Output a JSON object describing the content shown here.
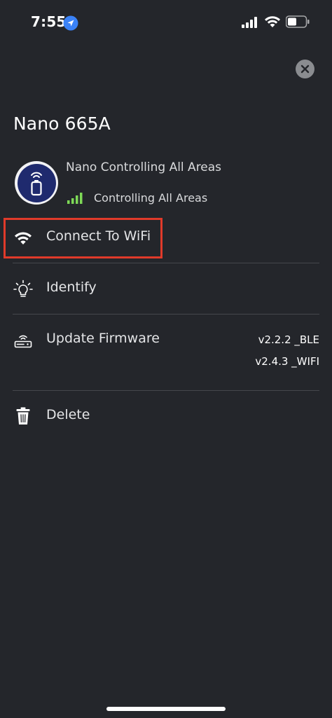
{
  "status_bar": {
    "time": "7:55"
  },
  "device": {
    "title": "Nano 665A",
    "name_line": "Nano Controlling All Areas",
    "status_line": "Controlling All Areas",
    "signal_color": "#4cd964",
    "avatar_color": "#1f2a6e"
  },
  "menu": {
    "connect_wifi": "Connect To WiFi",
    "identify": "Identify",
    "update_firmware": "Update Firmware",
    "fw_ble": "v2.2.2 _BLE",
    "fw_wifi": "v2.4.3 _WIFI",
    "delete": "Delete"
  },
  "colors": {
    "background": "#24262b",
    "highlight": "#e03a2a"
  }
}
